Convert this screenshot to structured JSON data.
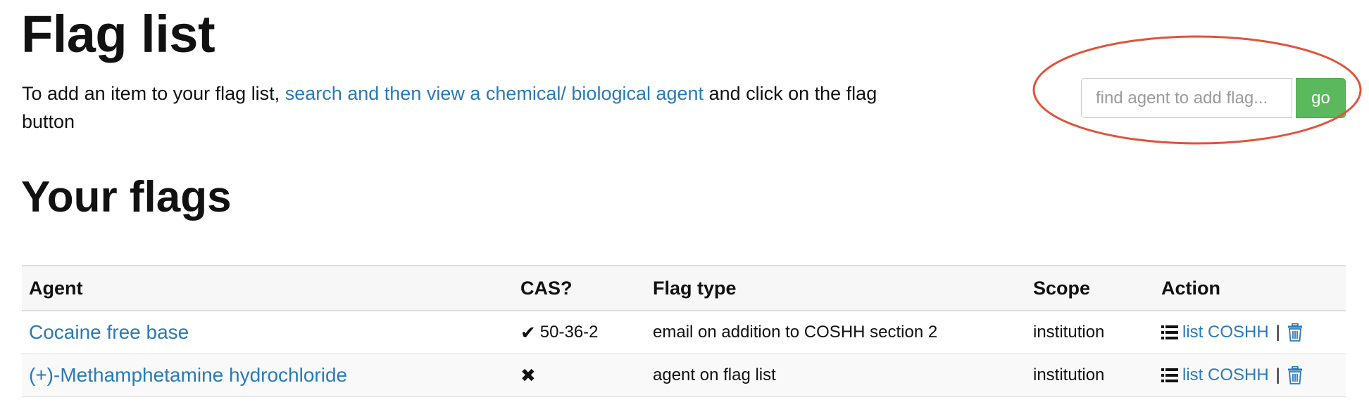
{
  "header": {
    "title": "Flag list",
    "intro_before": "To add an item to your flag list, ",
    "intro_link": "search and then view a chemical/ biological agent",
    "intro_after": " and click on the flag button"
  },
  "search": {
    "placeholder": "find agent to add flag...",
    "button_label": "go"
  },
  "flags": {
    "title": "Your flags",
    "columns": [
      "Agent",
      "CAS?",
      "Flag type",
      "Scope",
      "Action"
    ],
    "rows": [
      {
        "agent": "Cocaine free base",
        "cas_mark": "✔",
        "cas_number": "50-36-2",
        "flag_type": "email on addition to COSHH section 2",
        "scope": "institution",
        "action_label": "list COSHH",
        "separator": "|"
      },
      {
        "agent": "(+)-Methamphetamine hydrochloride",
        "cas_mark": "✖",
        "cas_number": "",
        "flag_type": "agent on flag list",
        "scope": "institution",
        "action_label": "list COSHH",
        "separator": "|"
      }
    ]
  },
  "colors": {
    "link": "#2a7ab8",
    "go_button": "#5cb85c",
    "highlight_ellipse": "#e0533a"
  },
  "icons": {
    "action_list": "list-icon",
    "action_delete": "trash-icon"
  }
}
